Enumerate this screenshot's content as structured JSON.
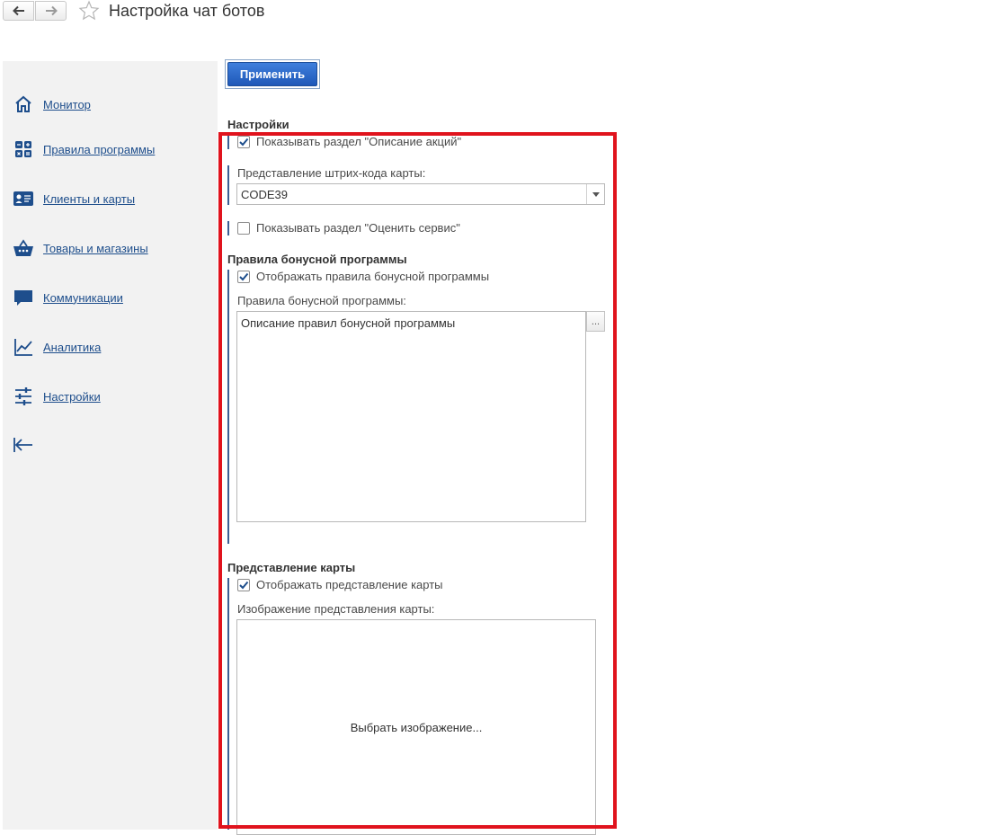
{
  "titlebar": {
    "title": "Настройка чат ботов",
    "back_icon": "arrow-left-icon",
    "forward_icon": "arrow-right-icon",
    "favorite_icon": "star-icon"
  },
  "sidebar": {
    "items": [
      {
        "label": "Монитор",
        "icon": "home-icon"
      },
      {
        "label": "Правила программы",
        "icon": "calculator-icon"
      },
      {
        "label": "Клиенты и карты",
        "icon": "id-card-icon"
      },
      {
        "label": "Товары и магазины",
        "icon": "basket-icon"
      },
      {
        "label": "Коммуникации",
        "icon": "chat-icon"
      },
      {
        "label": "Аналитика",
        "icon": "line-chart-icon"
      },
      {
        "label": "Настройки",
        "icon": "sliders-icon"
      }
    ],
    "collapse_icon": "collapse-left-icon"
  },
  "toolbar": {
    "apply_label": "Применить"
  },
  "settings": {
    "title": "Настройки",
    "show_promotions_label": "Показывать раздел \"Описание акций\"",
    "show_promotions_checked": true,
    "barcode_label": "Представление штрих-кода карты:",
    "barcode_value": "CODE39",
    "show_rating_label": "Показывать раздел \"Оценить сервис\"",
    "show_rating_checked": false
  },
  "bonus": {
    "title": "Правила бонусной программы",
    "show_rules_label": "Отображать правила бонусной программы",
    "show_rules_checked": true,
    "rules_label": "Правила бонусной программы:",
    "rules_value": "Описание правил бонусной программы",
    "open_button_label": "..."
  },
  "card": {
    "title": "Представление карты",
    "show_card_label": "Отображать представление карты",
    "show_card_checked": true,
    "image_label": "Изображение представления карты:",
    "image_placeholder": "Выбрать изображение..."
  },
  "colors": {
    "accent": "#1f58b8",
    "link": "#1e4e8c",
    "highlight": "#e0131d",
    "sidebar_bg": "#f2f2f2"
  }
}
